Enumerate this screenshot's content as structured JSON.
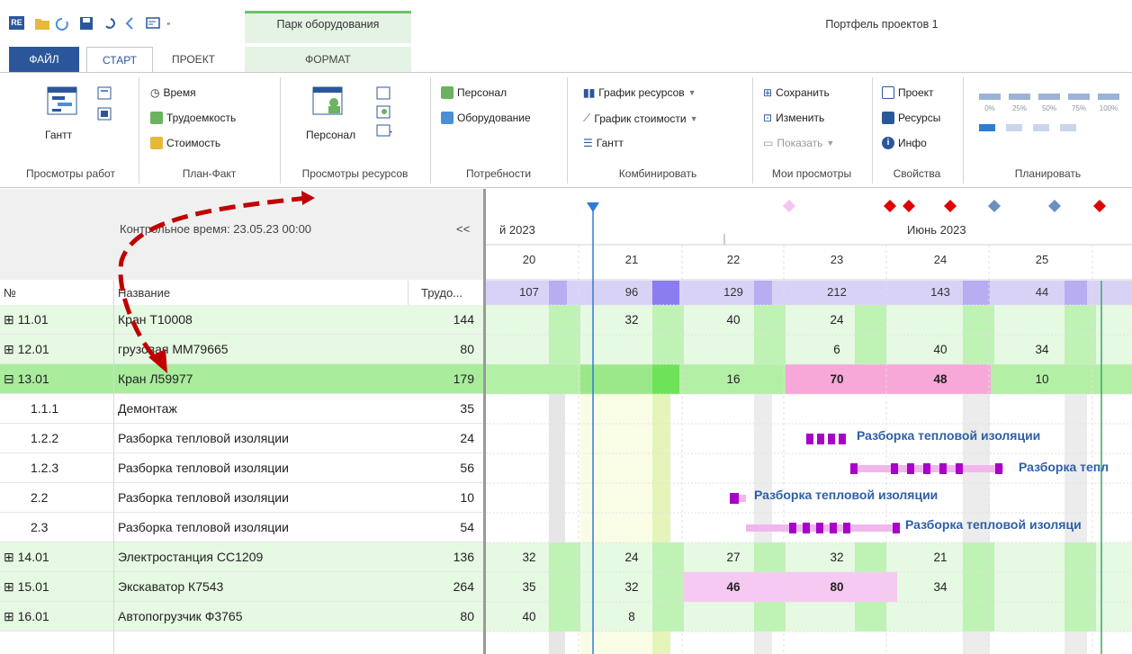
{
  "window": {
    "context_tab_title": "Парк оборудования",
    "doc_title": "Портфель проектов 1",
    "qat_icons": [
      "app-logo-icon",
      "open-folder-icon",
      "refresh-icon",
      "save-icon",
      "undo-icon",
      "back-icon",
      "view-icon",
      "more-icon"
    ]
  },
  "tabs": {
    "file": "ФАЙЛ",
    "start": "СТАРТ",
    "project": "ПРОЕКТ",
    "format": "ФОРМАТ"
  },
  "ribbon": {
    "work_views": {
      "label": "Просмотры работ",
      "gantt": "Гантт"
    },
    "plan_fact": {
      "label": "План-Факт",
      "time": "Время",
      "labor": "Трудоемкость",
      "cost": "Стоимость"
    },
    "resource_views": {
      "label": "Просмотры ресурсов",
      "personnel": "Персонал"
    },
    "needs": {
      "label": "Потребности",
      "personnel": "Персонал",
      "equipment": "Оборудование"
    },
    "combine": {
      "label": "Комбинировать",
      "resource_chart": "График ресурсов",
      "cost_chart": "График стоимости",
      "gantt": "Гантт"
    },
    "my_views": {
      "label": "Мои просмотры",
      "save": "Сохранить",
      "change": "Изменить",
      "show": "Показать"
    },
    "properties": {
      "label": "Свойства",
      "project": "Проект",
      "resources": "Ресурсы",
      "info": "Инфо"
    },
    "plan": {
      "label": "Планировать",
      "percents": [
        "0%",
        "25%",
        "50%",
        "75%",
        "100%"
      ]
    }
  },
  "grid": {
    "control_time": "Контрольное время: 23.05.23 00:00",
    "nav_prev": "<<",
    "columns": {
      "num": "№",
      "name": "Название",
      "trud": "Трудо..."
    },
    "rows": [
      {
        "num": "⊞ 11.01",
        "name": "Кран Т10008",
        "trud": "144",
        "kind": "group"
      },
      {
        "num": "⊞ 12.01",
        "name": "грузовая ММ79665",
        "trud": "80",
        "kind": "group"
      },
      {
        "num": "⊟ 13.01",
        "name": "Кран Л59977",
        "trud": "179",
        "kind": "sel"
      },
      {
        "num": "1.1.1",
        "name": "Демонтаж",
        "trud": "35",
        "kind": "task"
      },
      {
        "num": "1.2.2",
        "name": "Разборка тепловой изоляции",
        "trud": "24",
        "kind": "task"
      },
      {
        "num": "1.2.3",
        "name": "Разборка тепловой изоляции",
        "trud": "56",
        "kind": "task"
      },
      {
        "num": "2.2",
        "name": "Разборка тепловой изоляции",
        "trud": "10",
        "kind": "task"
      },
      {
        "num": "2.3",
        "name": "Разборка тепловой изоляции",
        "trud": "54",
        "kind": "task"
      },
      {
        "num": "⊞ 14.01",
        "name": "Электростанция СС1209",
        "trud": "136",
        "kind": "group"
      },
      {
        "num": "⊞ 15.01",
        "name": "Экскаватор К7543",
        "trud": "264",
        "kind": "group"
      },
      {
        "num": "⊞ 16.01",
        "name": "Автопогрузчик Ф3765",
        "trud": "80",
        "kind": "group"
      }
    ]
  },
  "timeline": {
    "month_prev": "й 2023",
    "month_cur": "Июнь 2023",
    "days": [
      "20",
      "21",
      "22",
      "23",
      "24",
      "25"
    ],
    "totals": [
      "107",
      "96",
      "129",
      "212",
      "143",
      "44"
    ]
  },
  "loads": {
    "r11": [
      "",
      "32",
      "40",
      "24",
      "",
      ""
    ],
    "r12": [
      "",
      "",
      "",
      "6",
      "40",
      "34"
    ],
    "r13": [
      "",
      "",
      "16",
      "70",
      "48",
      "10"
    ],
    "r14": [
      "32",
      "24",
      "27",
      "32",
      "21",
      ""
    ],
    "r15": [
      "35",
      "32",
      "46",
      "80",
      "34",
      ""
    ],
    "r16": [
      "40",
      "8",
      "",
      "",
      "",
      ""
    ]
  },
  "gantt_labels": {
    "a": "Разборка тепловой изоляции",
    "b": "Разборка тепл",
    "c": "Разборка тепловой изоляции",
    "d": "Разборка тепловой изоляци"
  },
  "colors": {
    "accent": "#2b579a",
    "selected_row": "#a8ec9c",
    "group_row": "#e6f9e3",
    "overload": "#f7a8d8",
    "bar": "#a800c8",
    "arrow": "#c00000"
  }
}
